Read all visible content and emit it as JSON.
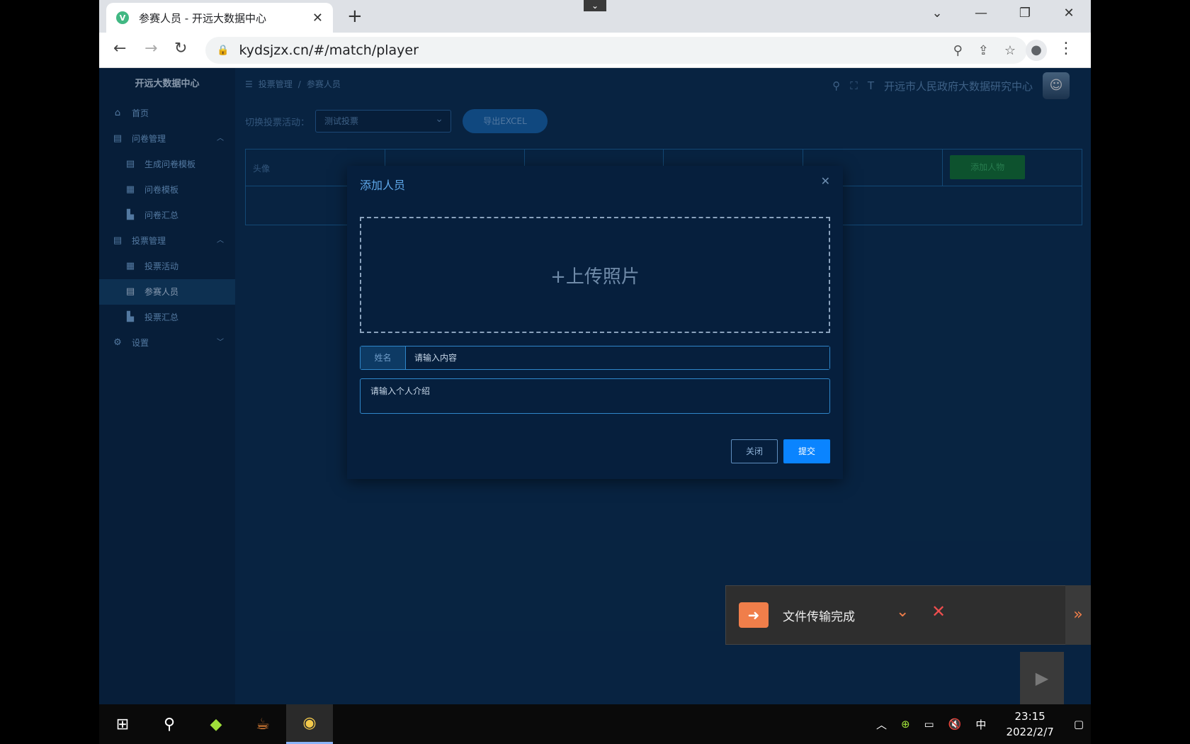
{
  "browser": {
    "tab_title": "参赛人员 - 开远大数据中心",
    "url": "kydsjzx.cn/#/match/player"
  },
  "app": {
    "brand": "开远大数据中心",
    "org_name": "开远市人民政府大数据研究中心",
    "breadcrumb": [
      "投票管理",
      "参赛人员"
    ]
  },
  "sidebar": {
    "items": [
      {
        "label": "首页",
        "icon": "home-icon"
      },
      {
        "label": "问卷管理",
        "icon": "document-icon"
      },
      {
        "label": "生成问卷模板",
        "icon": "document-icon"
      },
      {
        "label": "问卷模板",
        "icon": "grid-icon"
      },
      {
        "label": "问卷汇总",
        "icon": "bar-chart-icon"
      },
      {
        "label": "投票管理",
        "icon": "document-icon"
      },
      {
        "label": "投票活动",
        "icon": "grid-icon"
      },
      {
        "label": "参赛人员",
        "icon": "document-icon"
      },
      {
        "label": "投票汇总",
        "icon": "bar-chart-icon"
      },
      {
        "label": "设置",
        "icon": "gear-icon"
      }
    ]
  },
  "toolbar": {
    "switch_label": "切换投票活动：",
    "selected_activity": "测试投票",
    "export_label": "导出EXCEL"
  },
  "table": {
    "columns": [
      "头像",
      "",
      "",
      "",
      "",
      ""
    ],
    "add_label": "添加人物"
  },
  "dialog": {
    "title": "添加人员",
    "upload_label": "+上传照片",
    "name_label": "姓名",
    "name_placeholder": "请输入内容",
    "intro_placeholder": "请输入个人介绍",
    "close_label": "关闭",
    "submit_label": "提交"
  },
  "notification": {
    "text": "文件传输完成"
  },
  "taskbar": {
    "time": "23:15",
    "date": "2022/2/7",
    "ime": "中"
  }
}
